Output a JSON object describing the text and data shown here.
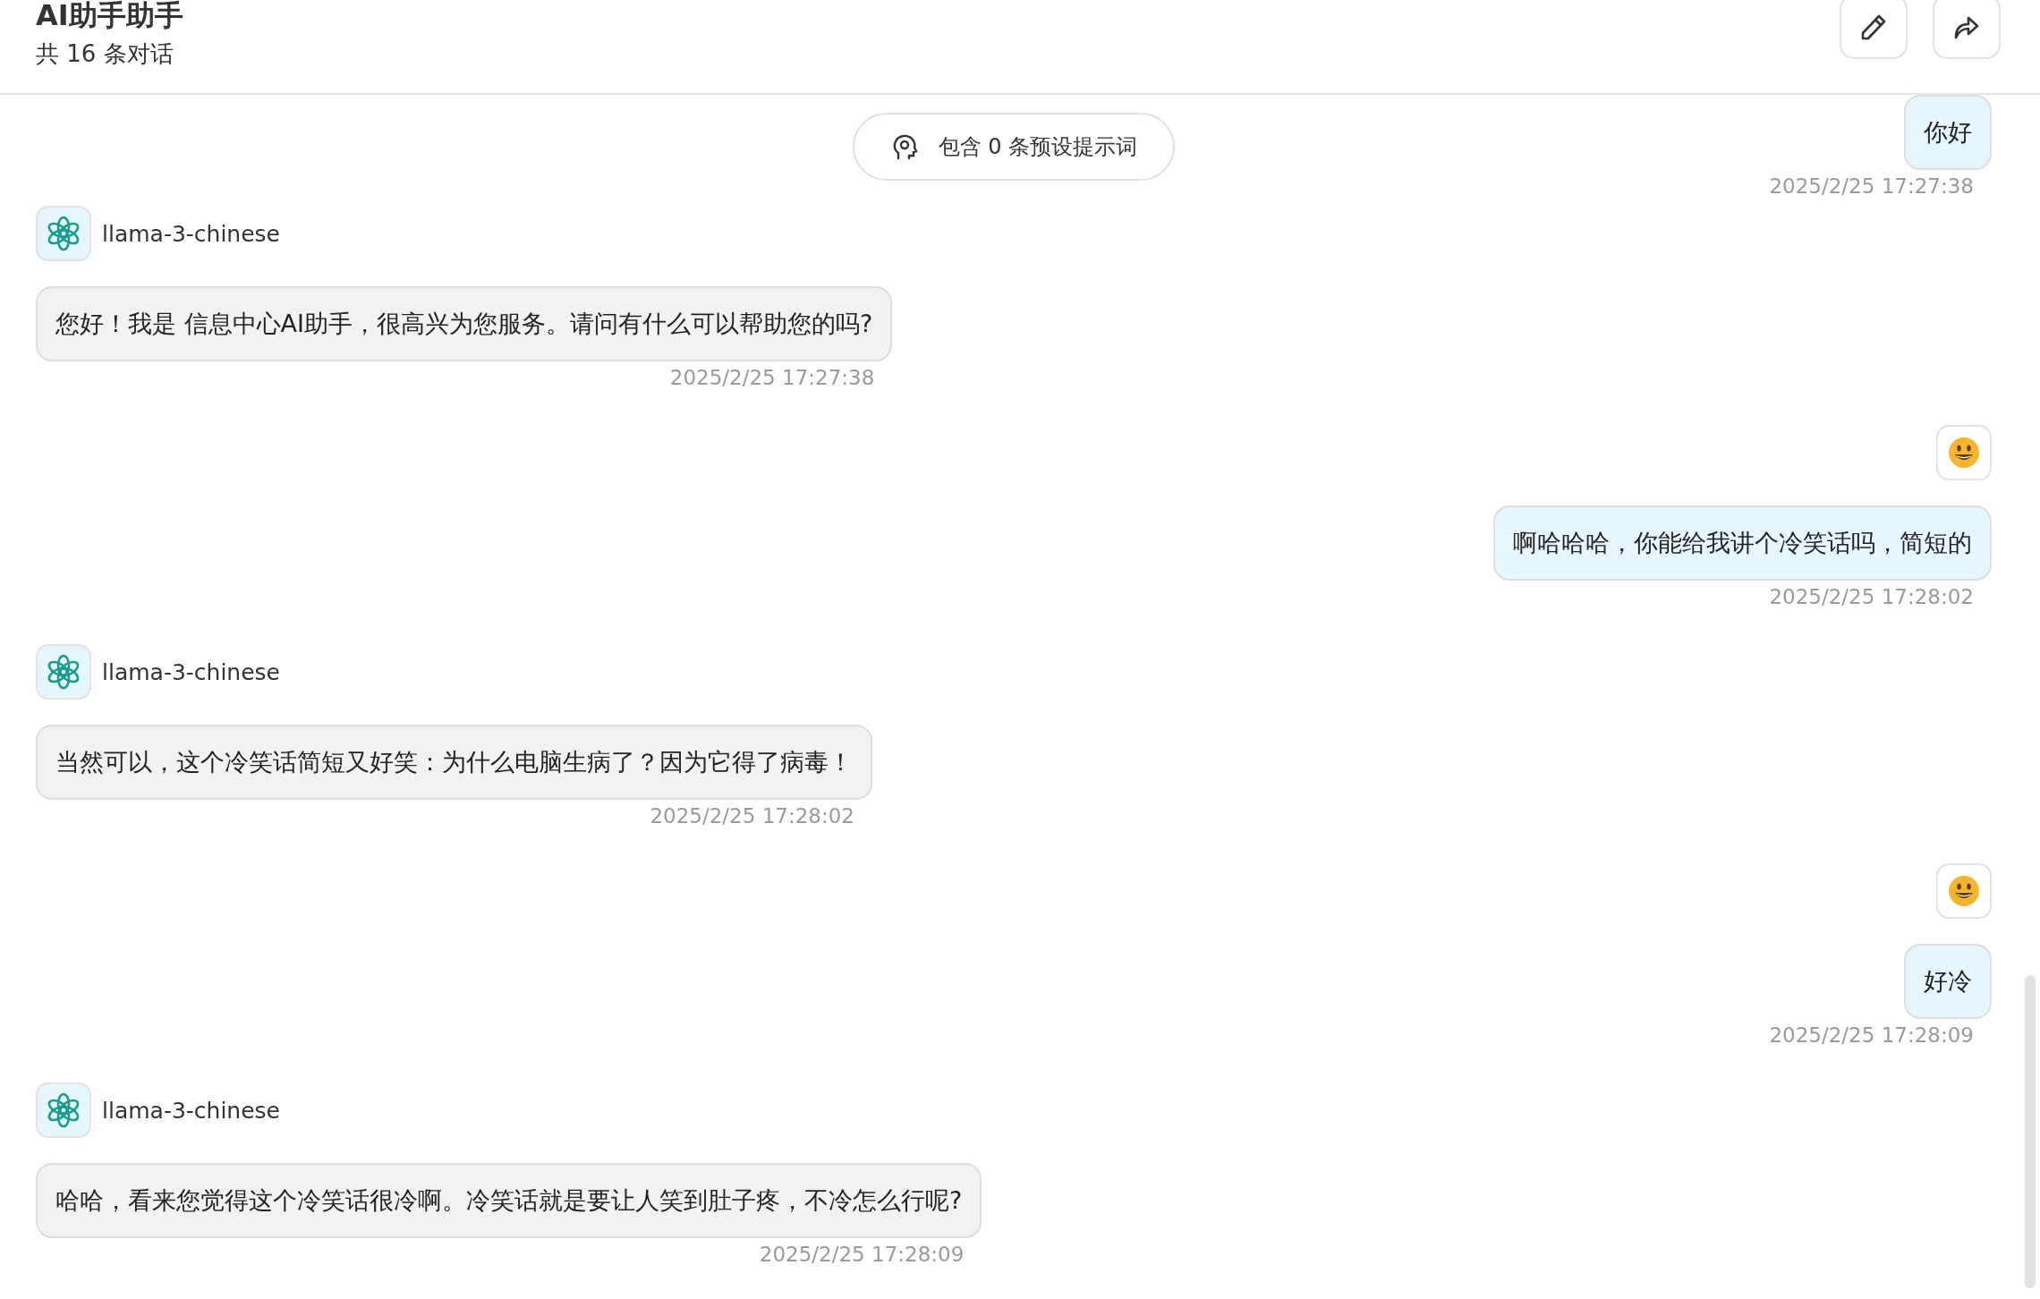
{
  "header": {
    "title": "AI助手助手",
    "subtitle": "共 16 条对话"
  },
  "actions": [
    {
      "kind": "edit"
    },
    {
      "kind": "share"
    }
  ],
  "preset_prompt": {
    "label": "包含 0 条预设提示词"
  },
  "messages": [
    {
      "kind": "user_partial",
      "text": "你好",
      "time": "2025/2/25 17:27:38"
    },
    {
      "kind": "assistant",
      "model": "llama-3-chinese",
      "text": "您好！我是 信息中心AI助手，很高兴为您服务。请问有什么可以帮助您的吗?",
      "time": "2025/2/25 17:27:38"
    },
    {
      "kind": "user",
      "text": "啊哈哈哈，你能给我讲个冷笑话吗，简短的",
      "time": "2025/2/25 17:28:02"
    },
    {
      "kind": "assistant",
      "model": "llama-3-chinese",
      "text": "当然可以，这个冷笑话简短又好笑：为什么电脑生病了？因为它得了病毒！",
      "time": "2025/2/25 17:28:02"
    },
    {
      "kind": "user",
      "text": "好冷",
      "time": "2025/2/25 17:28:09"
    },
    {
      "kind": "assistant",
      "model": "llama-3-chinese",
      "text": "哈哈，看来您觉得这个冷笑话很冷啊。冷笑话就是要让人笑到肚子疼，不冷怎么行呢?",
      "time": "2025/2/25 17:28:09"
    }
  ]
}
